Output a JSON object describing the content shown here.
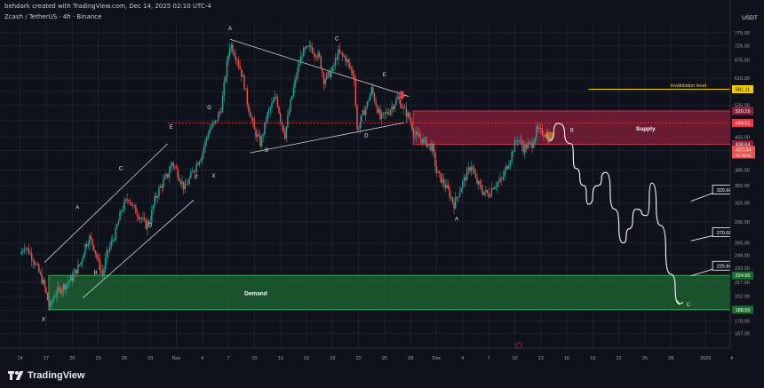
{
  "header": {
    "author_line": "behdark created with TradingView.com, Dec 14, 2025 02:10 UTC-4",
    "symbol_line": "Zcash / TetherUS · 4h · Binance"
  },
  "brand": {
    "name": "TradingView",
    "icon": "tradingview-logo-icon"
  },
  "colors": {
    "background": "#0f121a",
    "up_candle": "#26a69a",
    "down_candle": "#ef5350",
    "supply_zone": "#8a1f3a",
    "demand_zone": "#1e6b32",
    "invalidation_line": "#f2d000",
    "projection": "#ffffff"
  },
  "chart_data": {
    "type": "candlestick",
    "title": "",
    "y_unit": "USDT",
    "y_scale": "log",
    "ylim": [
      155,
      800
    ],
    "y_ticks": [
      775,
      725,
      675,
      615,
      575,
      535,
      495,
      455,
      425,
      385,
      355,
      325,
      295,
      265,
      249,
      233,
      217,
      202,
      188,
      178,
      167
    ],
    "x_ticks": [
      "14",
      "17",
      "20",
      "23",
      "26",
      "29",
      "Nov",
      "4",
      "7",
      "10",
      "13",
      "16",
      "19",
      "22",
      "25",
      "28",
      "Dec",
      "4",
      "7",
      "10",
      "13",
      "16",
      "19",
      "22",
      "25",
      "28",
      "2026",
      "4"
    ],
    "x_tick_days": [
      -17,
      -14,
      -11,
      -8,
      -5,
      -2,
      1,
      4,
      7,
      10,
      13,
      16,
      19,
      22,
      25,
      28,
      31,
      34,
      37,
      40,
      43,
      46,
      49,
      52,
      55,
      58,
      62,
      65
    ],
    "x_axis_start": "Oct 13, 2025",
    "price_path": [
      [
        -17,
        250
      ],
      [
        -16.5,
        262
      ],
      [
        -15.5,
        245
      ],
      [
        -15,
        232
      ],
      [
        -14.3,
        215
      ],
      [
        -13.6,
        190
      ],
      [
        -13,
        205
      ],
      [
        -12,
        212
      ],
      [
        -11,
        222
      ],
      [
        -10,
        240
      ],
      [
        -9.5,
        262
      ],
      [
        -9,
        272
      ],
      [
        -8.5,
        260
      ],
      [
        -8,
        240
      ],
      [
        -7.5,
        225
      ],
      [
        -7,
        250
      ],
      [
        -6,
        280
      ],
      [
        -5.3,
        315
      ],
      [
        -4.5,
        335
      ],
      [
        -4,
        318
      ],
      [
        -3,
        300
      ],
      [
        -2.5,
        290
      ],
      [
        -2,
        300
      ],
      [
        -1.5,
        330
      ],
      [
        -1,
        348
      ],
      [
        0,
        375
      ],
      [
        0.5,
        400
      ],
      [
        1,
        385
      ],
      [
        1.5,
        365
      ],
      [
        2,
        350
      ],
      [
        3,
        385
      ],
      [
        4,
        420
      ],
      [
        4.7,
        470
      ],
      [
        5.5,
        490
      ],
      [
        6.2,
        530
      ],
      [
        7.2,
        735
      ],
      [
        8,
        680
      ],
      [
        8.8,
        600
      ],
      [
        9.2,
        540
      ],
      [
        10,
        470
      ],
      [
        10.7,
        440
      ],
      [
        11.5,
        510
      ],
      [
        12.5,
        560
      ],
      [
        13,
        500
      ],
      [
        13.5,
        460
      ],
      [
        14,
        520
      ],
      [
        14.8,
        620
      ],
      [
        15.5,
        700
      ],
      [
        16.5,
        720
      ],
      [
        17.5,
        680
      ],
      [
        18,
        610
      ],
      [
        19,
        640
      ],
      [
        19.6,
        700
      ],
      [
        20.5,
        680
      ],
      [
        21.5,
        620
      ],
      [
        21.8,
        470
      ],
      [
        23,
        540
      ],
      [
        23.5,
        580
      ],
      [
        24,
        540
      ],
      [
        24.5,
        500
      ],
      [
        25.5,
        520
      ],
      [
        26.5,
        555
      ],
      [
        27.3,
        520
      ],
      [
        27.8,
        505
      ],
      [
        28.5,
        460
      ],
      [
        29.3,
        450
      ],
      [
        30,
        440
      ],
      [
        30.5,
        430
      ],
      [
        31,
        380
      ],
      [
        32,
        355
      ],
      [
        32.5,
        340
      ],
      [
        33,
        323
      ],
      [
        34,
        360
      ],
      [
        35,
        395
      ],
      [
        35.5,
        365
      ],
      [
        36.3,
        345
      ],
      [
        37,
        340
      ],
      [
        37.5,
        355
      ],
      [
        38.5,
        365
      ],
      [
        39.5,
        410
      ],
      [
        40.3,
        455
      ],
      [
        41,
        430
      ],
      [
        42,
        440
      ],
      [
        42.5,
        470
      ],
      [
        43.5,
        465
      ],
      [
        44,
        447
      ]
    ],
    "candle_wick_ratio": 0.35,
    "current_price": "420.34",
    "countdown": "01:49:41",
    "price_labels": [
      {
        "name": "invalidation-price",
        "value": 581.11,
        "text": "581.11",
        "color": "#f2d000",
        "text_color": "#000000"
      },
      {
        "name": "supply-top-price",
        "value": 520.15,
        "text": "520.15",
        "color": "#8a1f3a",
        "text_color": "#ffffff"
      },
      {
        "name": "dotted-level-price",
        "value": 489.01,
        "text": "489.01",
        "color": "#f23645",
        "text_color": "#ffffff"
      },
      {
        "name": "supply-bottom-price",
        "value": 438.64,
        "text": "438.64",
        "color": "#8a1f3a",
        "text_color": "#ffffff"
      },
      {
        "name": "demand-top-price",
        "value": 224.56,
        "text": "224.56",
        "color": "#1e6b32",
        "text_color": "#ffffff"
      },
      {
        "name": "demand-bottom-price",
        "value": 188.55,
        "text": "188.55",
        "color": "#1e6b32",
        "text_color": "#ffffff"
      }
    ],
    "zones": [
      {
        "name": "supply-zone",
        "label": "Supply",
        "x_start": 28.3,
        "x_end": 71.5,
        "y_low": 438.64,
        "y_high": 520.15,
        "fill": "#8a1f3a",
        "stroke": "#c2334f"
      },
      {
        "name": "demand-zone",
        "label": "Demand",
        "x_start": -13.7,
        "x_end": 71.5,
        "y_low": 188.55,
        "y_high": 224.56,
        "fill": "#1e6b32",
        "stroke": "#3fa35b"
      }
    ],
    "invalidation": {
      "label": "Invalidation level",
      "value": 581.11,
      "x_start": 48.5,
      "x_end": 71.5
    },
    "dotted_level": {
      "value": 489.01,
      "x_start": 0,
      "x_end": 71.5
    },
    "channel_lines": [
      [
        [
          -14.2,
          240
        ],
        [
          0,
          440
        ]
      ],
      [
        [
          -9.8,
          200
        ],
        [
          3,
          330
        ]
      ],
      [
        [
          7.2,
          750
        ],
        [
          27.8,
          560
        ]
      ],
      [
        [
          9.5,
          420
        ],
        [
          27.3,
          490
        ]
      ]
    ],
    "projection": [
      [
        44,
        447
      ],
      [
        45,
        488
      ],
      [
        46.5,
        440
      ],
      [
        47,
        388
      ],
      [
        48,
        355
      ],
      [
        48.5,
        323
      ],
      [
        49.5,
        355
      ],
      [
        50.5,
        380
      ],
      [
        51.5,
        315
      ],
      [
        52.5,
        265
      ],
      [
        53.2,
        285
      ],
      [
        54,
        315
      ],
      [
        55.2,
        305
      ],
      [
        55.8,
        360
      ],
      [
        56.8,
        290
      ],
      [
        58,
        226
      ],
      [
        59,
        194
      ]
    ],
    "wave_labels": [
      {
        "text": "X",
        "x": -14.3,
        "y": 178
      },
      {
        "text": "A",
        "x": -10.4,
        "y": 315
      },
      {
        "text": "B",
        "x": -8.3,
        "y": 226
      },
      {
        "text": "C",
        "x": -5.4,
        "y": 385
      },
      {
        "text": "D",
        "x": -2.0,
        "y": 288
      },
      {
        "text": "E",
        "x": 0.4,
        "y": 475
      },
      {
        "text": "F",
        "x": 3.3,
        "y": 367
      },
      {
        "text": "G",
        "x": 4.8,
        "y": 525
      },
      {
        "text": "X",
        "x": 5.3,
        "y": 370
      },
      {
        "text": "A",
        "x": 7.2,
        "y": 785
      },
      {
        "text": "B",
        "x": 11.4,
        "y": 422
      },
      {
        "text": "C",
        "x": 19.5,
        "y": 745
      },
      {
        "text": "D",
        "x": 22.9,
        "y": 455
      },
      {
        "text": "E",
        "x": 25.0,
        "y": 620
      },
      {
        "text": "A",
        "x": 33.3,
        "y": 297
      },
      {
        "text": "B",
        "x": 46.6,
        "y": 468
      },
      {
        "text": "C",
        "x": 60.0,
        "y": 192
      }
    ],
    "target_labels": [
      {
        "text": "329.66",
        "x": 62.8,
        "y": 348,
        "ptr_x": 60.3,
        "ptr_y": 328
      },
      {
        "text": "270.08",
        "x": 62.8,
        "y": 280,
        "ptr_x": 60.3,
        "ptr_y": 268
      },
      {
        "text": "225.60",
        "x": 62.8,
        "y": 236,
        "ptr_x": 60.3,
        "ptr_y": 224
      }
    ],
    "arrow_marker": {
      "x": 27.0,
      "y": 558
    }
  }
}
